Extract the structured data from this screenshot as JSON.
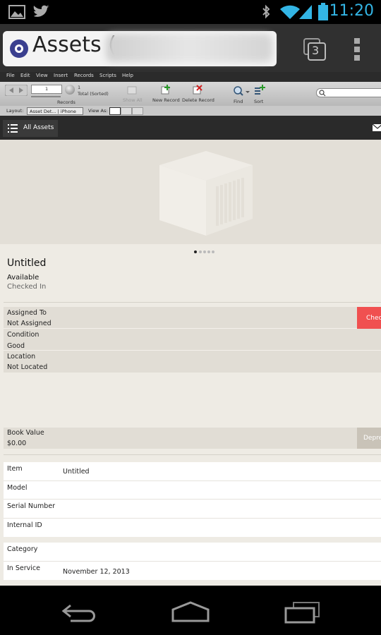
{
  "status_bar": {
    "time": "11:20"
  },
  "browser": {
    "tab_title": "Assets (",
    "tab_count": "3"
  },
  "fm_menu": [
    "File",
    "Edit",
    "View",
    "Insert",
    "Records",
    "Scripts",
    "Help"
  ],
  "fm_toolbar": {
    "record_number": "1",
    "record_total": "1",
    "record_total_label": "Total (Sorted)",
    "records_label": "Records",
    "show_all": "Show All",
    "new_record": "New Record",
    "delete_record": "Delete Record",
    "find": "Find",
    "sort": "Sort",
    "search_placeholder": ""
  },
  "fm_layout_bar": {
    "layout_label": "Layout:",
    "layout_value": "Asset Det... | iPhone",
    "view_as_label": "View As:"
  },
  "app_header": {
    "all_assets": "All Assets"
  },
  "asset": {
    "name": "Untitled",
    "status": "Available",
    "checked_status": "Checked In"
  },
  "assignment": {
    "assigned_to_label": "Assigned To",
    "assigned_to_value": "Not Assigned",
    "condition_label": "Condition",
    "condition_value": "Good",
    "location_label": "Location",
    "location_value": "Not Located",
    "checkout_button": "Chec"
  },
  "value": {
    "book_value_label": "Book Value",
    "book_value": "$0.00",
    "depreciation_button": "Depre"
  },
  "details": {
    "item_label": "Item",
    "item_value": "Untitled",
    "model_label": "Model",
    "serial_label": "Serial Number",
    "internal_id_label": "Internal ID",
    "category_label": "Category",
    "in_service_label": "In Service",
    "in_service_value": "November 12, 2013"
  },
  "colors": {
    "checkout_button": "#f05050",
    "accent": "#33b5e5"
  }
}
